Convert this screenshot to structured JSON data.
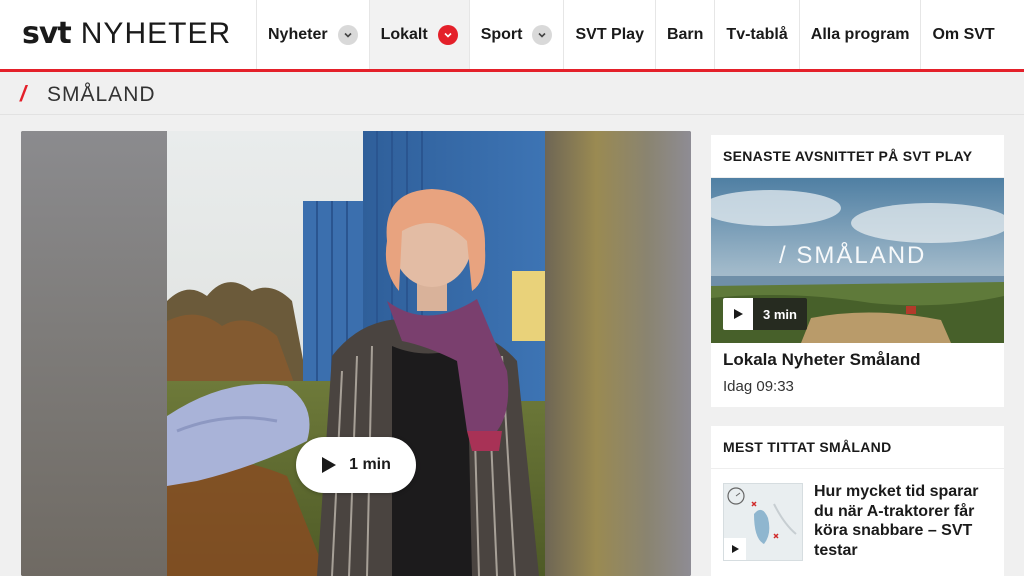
{
  "header": {
    "logo_svt": "svt",
    "logo_product": "NYHETER",
    "nav": [
      {
        "label": "Nyheter",
        "has_dropdown": true,
        "active": false
      },
      {
        "label": "Lokalt",
        "has_dropdown": true,
        "active": true
      },
      {
        "label": "Sport",
        "has_dropdown": true,
        "active": false
      },
      {
        "label": "SVT Play",
        "has_dropdown": false,
        "active": false
      },
      {
        "label": "Barn",
        "has_dropdown": false,
        "active": false
      },
      {
        "label": "Tv-tablå",
        "has_dropdown": false,
        "active": false
      },
      {
        "label": "Alla program",
        "has_dropdown": false,
        "active": false
      },
      {
        "label": "Om SVT",
        "has_dropdown": false,
        "active": false
      }
    ]
  },
  "section": {
    "slash": "/",
    "title": "SMÅLAND"
  },
  "main_video": {
    "duration": "1 min"
  },
  "latest_episode": {
    "heading": "SENASTE AVSNITTET PÅ SVT PLAY",
    "thumb_overlay": "/ SMÅLAND",
    "duration": "3 min",
    "title": "Lokala Nyheter Småland",
    "time": "Idag 09:33"
  },
  "most_watched": {
    "heading": "MEST TITTAT SMÅLAND",
    "items": [
      {
        "title": "Hur mycket tid sparar du när A-traktorer får köra snabbare – SVT testar"
      }
    ]
  },
  "colors": {
    "accent": "#e4202a",
    "background": "#f0f0f0",
    "card": "#ffffff"
  }
}
